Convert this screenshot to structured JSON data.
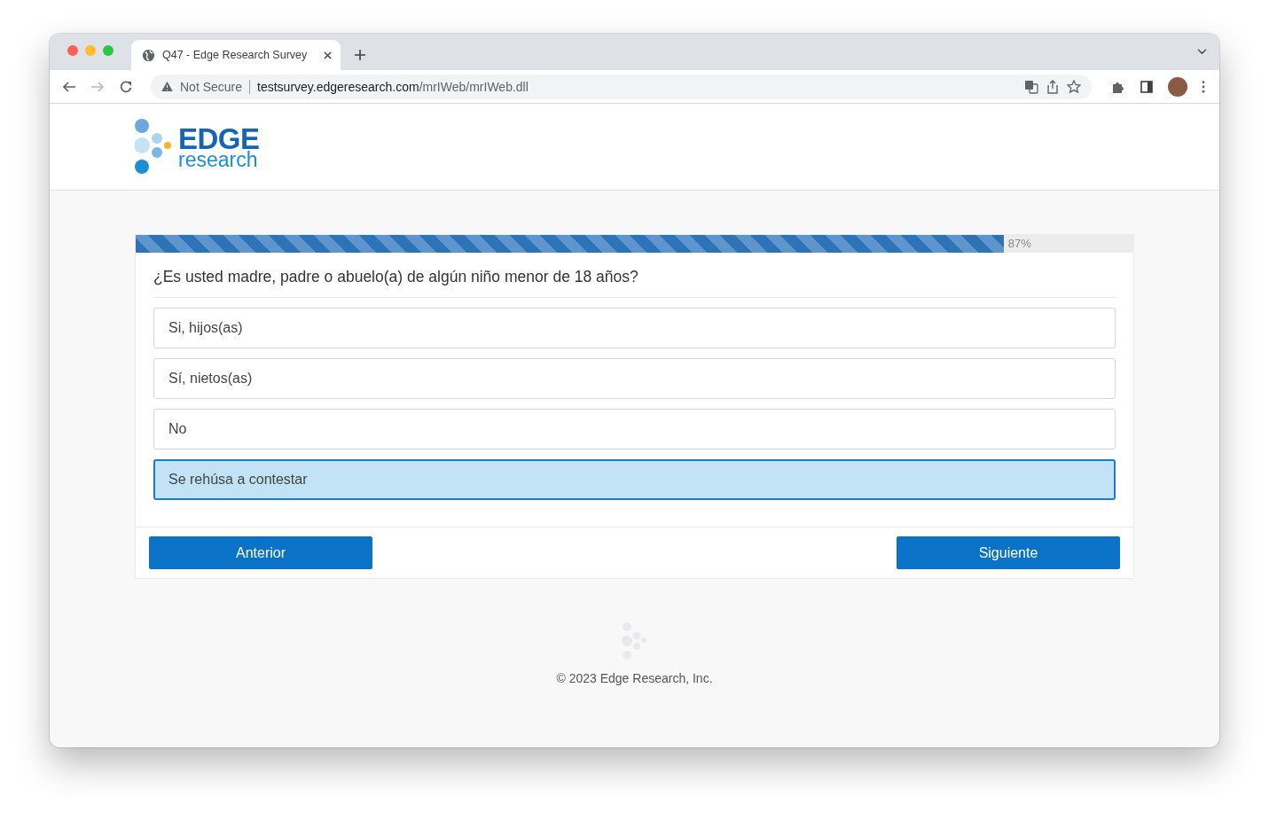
{
  "browser": {
    "tab": {
      "title": "Q47 - Edge Research Survey"
    },
    "security": "Not Secure",
    "url": {
      "host": "testsurvey.edgeresearch.com",
      "path": "/mrIWeb/mrIWeb.dll"
    }
  },
  "logo": {
    "name": "EDGE",
    "sub": "research"
  },
  "progress": {
    "level": 0.87,
    "reading": "87%"
  },
  "question": "¿Es usted madre, padre o abuelo(a) de algún niño menor de 18 años?",
  "options": [
    {
      "label": "Si, hijos(as)",
      "selected": false
    },
    {
      "label": "Sí, nietos(as)",
      "selected": false
    },
    {
      "label": "No",
      "selected": false
    },
    {
      "label": "Se rehúsa a contestar",
      "selected": true
    }
  ],
  "buttons": {
    "back": "Anterior",
    "next": "Siguiente"
  },
  "footer": "© 2023 Edge Research, Inc."
}
